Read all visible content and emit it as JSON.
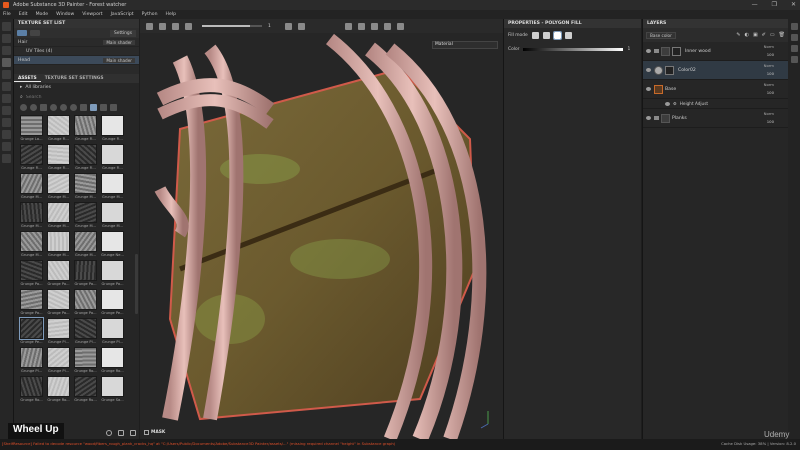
{
  "window": {
    "title": "Adobe Substance 3D Painter - Forest watcher",
    "controls": [
      "—",
      "❐",
      "✕"
    ]
  },
  "menu": [
    "File",
    "Edit",
    "Mode",
    "Window",
    "Viewport",
    "JavaScript",
    "Python",
    "Help"
  ],
  "texture_set_list": {
    "title": "TEXTURE SET LIST",
    "settings_label": "Settings",
    "rows": [
      {
        "name": "Hair",
        "shader": "Main shader"
      },
      {
        "name": "UV Tiles (4)",
        "shader": ""
      },
      {
        "name": "Head",
        "shader": "Main shader"
      }
    ]
  },
  "assets": {
    "tabs": [
      "ASSETS",
      "TEXTURE SET SETTINGS"
    ],
    "library_label": "All libraries",
    "search_placeholder": "Search",
    "thumbnails": [
      "Grunge La...",
      "Grunge Fi...",
      "Grunge Fi...",
      "Grunge Fi...",
      "Grunge Fi...",
      "Grunge Fi...",
      "Grunge Fi...",
      "Grunge Fi...",
      "Grunge M...",
      "Grunge M...",
      "Grunge M...",
      "Grunge M...",
      "Grunge M...",
      "Grunge M...",
      "Grunge M...",
      "Grunge M...",
      "Grunge M...",
      "Grunge M...",
      "Grunge M...",
      "Grunge Ne...",
      "Grunge Pa...",
      "Grunge Pa...",
      "Grunge Pa...",
      "Grunge Pa...",
      "Grunge Pa...",
      "Grunge Pa...",
      "Grunge Pa...",
      "Grunge Pe...",
      "Grunge Pe...",
      "Grunge Pl...",
      "Grunge Pl...",
      "Grunge Pl...",
      "Grunge Pl...",
      "Grunge Pl...",
      "Grunge Ro...",
      "Grunge Ro...",
      "Grunge Ro...",
      "Grunge Ro...",
      "Grunge Ru...",
      "Grunge Sa..."
    ]
  },
  "viewport": {
    "brush_value": "1",
    "material_select": "Material",
    "mask_label": "MASK"
  },
  "properties": {
    "title": "PROPERTIES - POLYGON FILL",
    "fill_mode_label": "Fill mode",
    "color_label": "Color",
    "color_value": "1"
  },
  "layers": {
    "title": "LAYERS",
    "blend_select": "Base color",
    "items": [
      {
        "name": "Inner wood",
        "blend": "Norm",
        "opacity": "100",
        "type": "fill"
      },
      {
        "name": "Color02",
        "blend": "Norm",
        "opacity": "100",
        "type": "paint"
      },
      {
        "name": "Base",
        "blend": "Norm",
        "opacity": "100",
        "type": "fill"
      },
      {
        "name": "Planks",
        "blend": "Norm",
        "opacity": "100",
        "type": "folder"
      }
    ],
    "sub_effect": "Height Adjust"
  },
  "status": {
    "error_text": "[ShelfResource] Failed to decode resource \"wood/fibers_rough_plank_cracks_hq\" at \"C:/Users/Public/Documents/Adobe/Substance3D Painter/assets/...\" (missing required channel \"height\" in Substance graph)",
    "cache": "Cache Disk Usage: 38% | Version: 8.2.0"
  },
  "overlay_caption": "Wheel Up",
  "watermark": "Udemy",
  "colors": {
    "accent": "#7e9bbb",
    "error": "#e0502a"
  }
}
